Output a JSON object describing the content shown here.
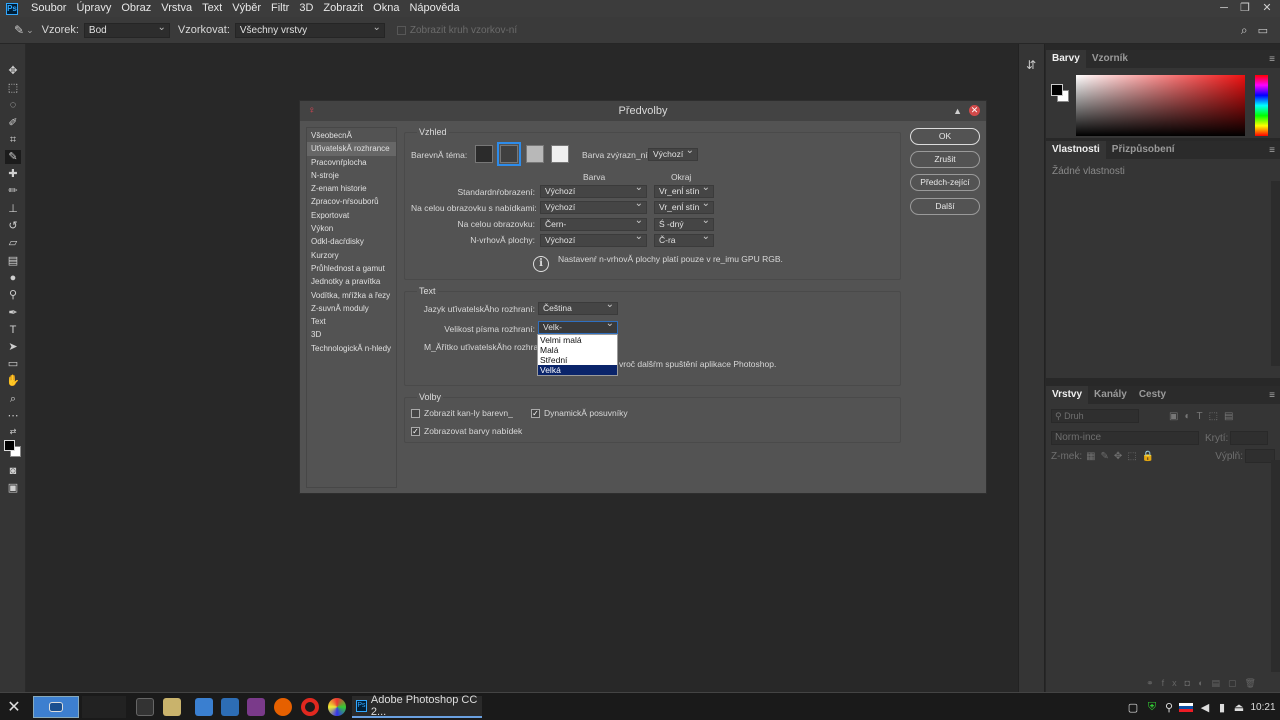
{
  "app": {
    "logo": "Ps"
  },
  "menubar": [
    "Soubor",
    "Úpravy",
    "Obraz",
    "Vrstva",
    "Text",
    "Výběr",
    "Filtr",
    "3D",
    "Zobrazit",
    "Okna",
    "Nápověda"
  ],
  "options_bar": {
    "sample_label": "Vzorek:",
    "sample_value": "Bod",
    "sample_layers_label": "Vzorkovat:",
    "sample_layers_value": "Všechny vrstvy",
    "show_ring_label": "Zobrazit kruh vzorkov-ní"
  },
  "panels": {
    "color_tabs": [
      "Barvy",
      "Vzorník"
    ],
    "properties_tabs": [
      "Vlastnosti",
      "Přizpůsobení"
    ],
    "properties_empty": "Žádné vlastnosti",
    "layers_tabs": [
      "Vrstvy",
      "Kanály",
      "Cesty"
    ],
    "layers_filter": "Druh",
    "blend_mode": "Norm-ince",
    "opacity_label": "Krytí:",
    "lock_label": "Z-mek:",
    "fill_label": "Výplň:"
  },
  "dialog": {
    "title": "Předvolby",
    "nav": [
      "VšeobecnĂ",
      "UťivatelskĂ rozhrance",
      "Pracovnŕplocha",
      "N-stroje",
      "Z-enam historie",
      "Zpracov-nŕsouborů",
      "Exportovat",
      "Výkon",
      "Odkl-dacŕdisky",
      "Kurzory",
      "Průhlednost a gamut",
      "Jednotky a pravítka",
      "Vodítka, mŕížka a řezy",
      "Z-suvnĂ moduly",
      "Text",
      "3D",
      "TechnologickĂ n-hledy"
    ],
    "nav_selected": 1,
    "appearance": {
      "title": "Vzhled",
      "theme_label": "BarevnĂ téma:",
      "highlight_label": "Barva zvýrazn_ní:",
      "highlight_value": "Výchozí",
      "col_color": "Barva",
      "col_border": "Okraj",
      "rows": [
        {
          "label": "Standardnŕobrazení:",
          "color": "Výchozí",
          "border": "Vr_enĺ stín"
        },
        {
          "label": "Na celou obrazovku s nabídkami:",
          "color": "Výchozí",
          "border": "Vr_enĺ stín"
        },
        {
          "label": "Na celou obrazovku:",
          "color": "Čern-",
          "border": "Ś -dný"
        },
        {
          "label": "N-vrhovĂ plochy:",
          "color": "Výchozí",
          "border": "Č-ra"
        }
      ],
      "info": "Nastavenŕ n-vrhovĂ plochy platí pouze v re_imu GPU RGB."
    },
    "text_group": {
      "title": "Text",
      "ui_lang_label": "Jazyk uťivatelskĂho rozhraní:",
      "ui_lang_value": "Čeština",
      "font_size_label": "Velikost písma rozhraní:",
      "font_size_value": "Velk-",
      "ui_scale_label": "M_Ăřítko uťivatelskĂho rozhraní",
      "restart_note": "vroč dalšŕm spuštění aplikace Photoshop.",
      "dropdown_options": [
        "Velmi malá",
        "Malá",
        "Střední",
        "Velká"
      ],
      "dropdown_highlight": 3
    },
    "options": {
      "title": "Volby",
      "show_channels_label": "Zobrazit kan-ly barevn_",
      "show_channels_checked": false,
      "dynamic_sliders_label": "DynamickĂ posuvníky",
      "dynamic_sliders_checked": true,
      "menu_colors_label": "Zobrazovat barvy nabídek",
      "menu_colors_checked": true
    },
    "buttons": {
      "ok": "OK",
      "cancel": "Zrušit",
      "prev": "Předch-zející",
      "next": "Další"
    }
  },
  "taskbar": {
    "active_app_label": "Adobe Photoshop CC 2...",
    "clock": "10:21"
  },
  "colors": {
    "accent": "#2d8ceb",
    "selection": "#0a246a",
    "close": "#d24a4a"
  }
}
